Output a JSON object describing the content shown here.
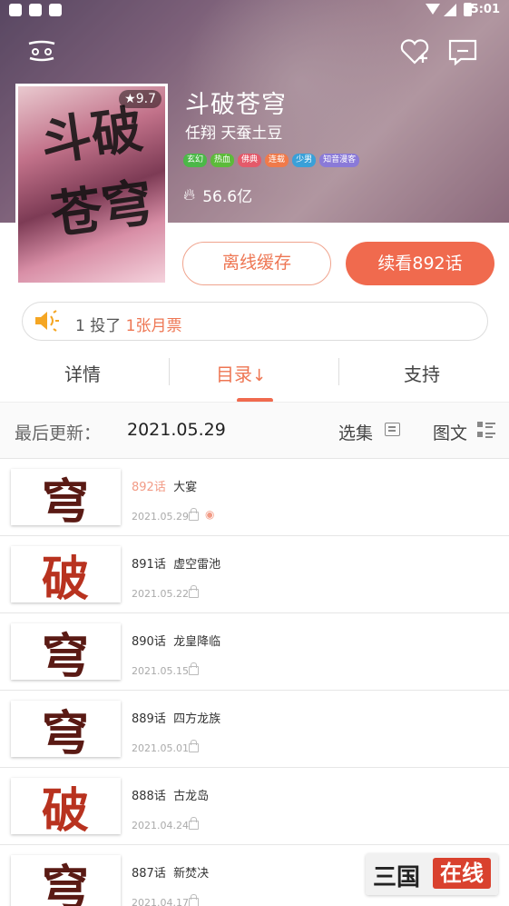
{
  "status_bar": {
    "time": "5:01"
  },
  "comic": {
    "title": "斗破苍穹",
    "authors": "任翔 天蚕土豆",
    "rating": "9.7",
    "cover_text": "斗破苍穹",
    "tags": [
      {
        "label": "玄幻",
        "color": "#4cb848"
      },
      {
        "label": "热血",
        "color": "#5cbb3a"
      },
      {
        "label": "佛典",
        "color": "#e45a6a"
      },
      {
        "label": "连载",
        "color": "#f07a4a"
      },
      {
        "label": "少男",
        "color": "#3aa0d8"
      },
      {
        "label": "知音漫客",
        "color": "#8a7ad8"
      }
    ],
    "heat": "56.6亿"
  },
  "actions": {
    "offline_label": "离线缓存",
    "continue_label": "续看892话"
  },
  "vote": {
    "count": "1",
    "text": "投了",
    "highlight": "1张月票"
  },
  "tabs": [
    {
      "label": "详情",
      "active": false
    },
    {
      "label": "目录",
      "active": true,
      "sort_icon": "↓"
    },
    {
      "label": "支持",
      "active": false
    }
  ],
  "update": {
    "label": "最后更新：",
    "date": "2021.05.29",
    "select_label": "选集",
    "view_label": "图文"
  },
  "chapters": [
    {
      "number": "892话",
      "name": "大宴",
      "date": "2021.05.29",
      "read": true,
      "glyph": "穹"
    },
    {
      "number": "891话",
      "name": "虚空雷池",
      "date": "2021.05.22",
      "read": false,
      "glyph": "破"
    },
    {
      "number": "890话",
      "name": "龙皇降临",
      "date": "2021.05.15",
      "read": false,
      "glyph": "穹"
    },
    {
      "number": "889话",
      "name": "四方龙族",
      "date": "2021.05.01",
      "read": false,
      "glyph": "穹"
    },
    {
      "number": "888话",
      "name": "古龙岛",
      "date": "2021.04.24",
      "read": false,
      "glyph": "破"
    },
    {
      "number": "887话",
      "name": "新焚决",
      "date": "2021.04.17",
      "read": false,
      "glyph": "穹"
    }
  ],
  "watermark": {
    "left": "三国",
    "right": "在线"
  },
  "colors": {
    "accent": "#f06a4e",
    "read": "#f29b86"
  }
}
